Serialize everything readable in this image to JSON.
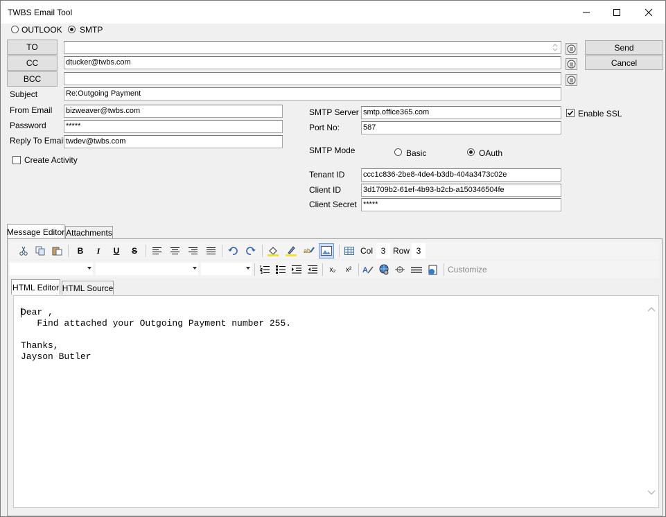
{
  "window": {
    "title": "TWBS Email Tool"
  },
  "mode": {
    "outlook": "OUTLOOK",
    "smtp": "SMTP"
  },
  "recipients": {
    "to_label": "TO",
    "to_value": "",
    "cc_label": "CC",
    "cc_value": "dtucker@twbs.com",
    "bcc_label": "BCC",
    "bcc_value": ""
  },
  "actions": {
    "send": "Send",
    "cancel": "Cancel"
  },
  "subject": {
    "label": "Subject",
    "value": "Re:Outgoing Payment"
  },
  "account": {
    "from_label": "From Email",
    "from_value": "bizweaver@twbs.com",
    "password_label": "Password",
    "password_value": "*****",
    "reply_label": "Reply To Email",
    "reply_value": "twdev@twbs.com",
    "create_activity": "Create Activity"
  },
  "smtp": {
    "server_label": "SMTP Server",
    "server_value": "smtp.office365.com",
    "port_label": "Port No:",
    "port_value": "587",
    "enable_ssl": "Enable SSL",
    "mode_label": "SMTP Mode",
    "mode_basic": "Basic",
    "mode_oauth": "OAuth",
    "tenant_label": "Tenant ID",
    "tenant_value": "ccc1c836-2be8-4de4-b3db-404a3473c02e",
    "client_label": "Client ID",
    "client_value": "3d1709b2-61ef-4b93-b2cb-a150346504fe",
    "secret_label": "Client Secret",
    "secret_value": "*****"
  },
  "tabs": {
    "message_editor": "Message Editor",
    "attachments": "Attachments",
    "html_editor": "HTML Editor",
    "html_source": "HTML Source"
  },
  "toolbar": {
    "bold": "B",
    "italic": "I",
    "underline": "U",
    "strike": "S",
    "col_label": "Col",
    "col_value": "3",
    "row_label": "Row",
    "row_value": "3",
    "customize": "Customize",
    "subscript": "x₂",
    "superscript": "x²"
  },
  "body": {
    "line1": "Dear ,",
    "line2": "   Find attached your Outgoing Payment number 255.",
    "line3": "",
    "line4": "Thanks,",
    "line5": "Jayson Butler"
  }
}
